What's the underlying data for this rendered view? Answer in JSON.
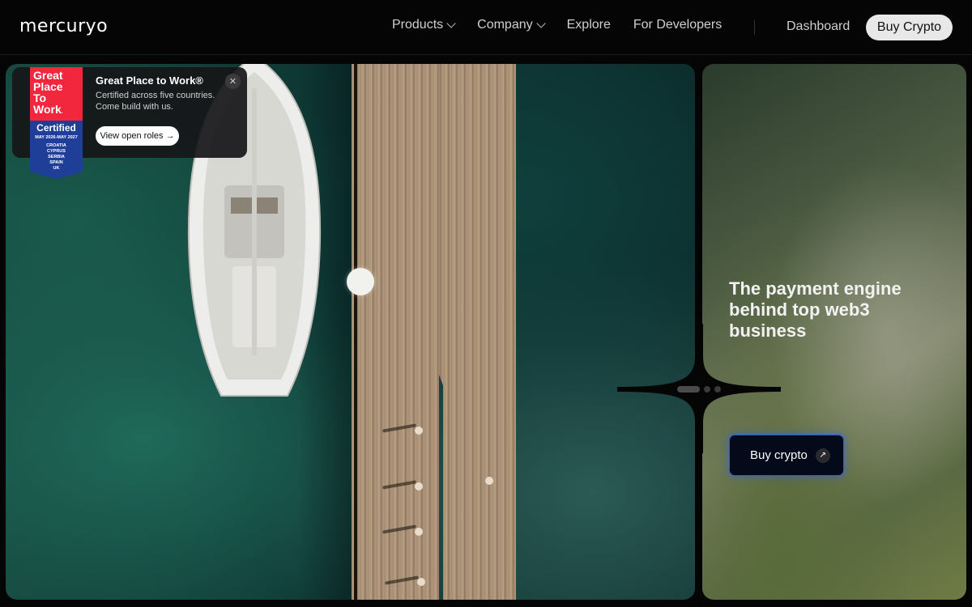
{
  "nav": {
    "logo": "mercuryo",
    "links": [
      {
        "label": "Products",
        "has_dropdown": true
      },
      {
        "label": "Company",
        "has_dropdown": true
      },
      {
        "label": "Explore",
        "has_dropdown": false
      },
      {
        "label": "For Developers",
        "has_dropdown": false
      }
    ],
    "dashboard": "Dashboard",
    "buy_crypto": "Buy Crypto"
  },
  "award": {
    "badge": {
      "line1": "Great",
      "line2": "Place",
      "line3": "To",
      "line4": "Work",
      "certified": "Certified",
      "dates": "MAY 2026-MAY 2027",
      "countries": [
        "CROATIA",
        "CYPRUS",
        "SERBIA",
        "SPAIN",
        "UK"
      ]
    },
    "title": "Great Place to Work®",
    "subtitle": "Certified across five countries. Come build with us.",
    "button": "View open roles →",
    "close_icon": "close-icon"
  },
  "hero": {
    "headline": "The payment engine behind top web3 business",
    "cta": "Buy crypto",
    "cta_icon": "arrow-up-right-icon"
  },
  "slider": {
    "count": 3,
    "active": 0
  },
  "colors": {
    "background": "#050505",
    "accent": "#1e5cff",
    "badge_red": "#f2263d",
    "badge_blue": "#1f3e98"
  }
}
